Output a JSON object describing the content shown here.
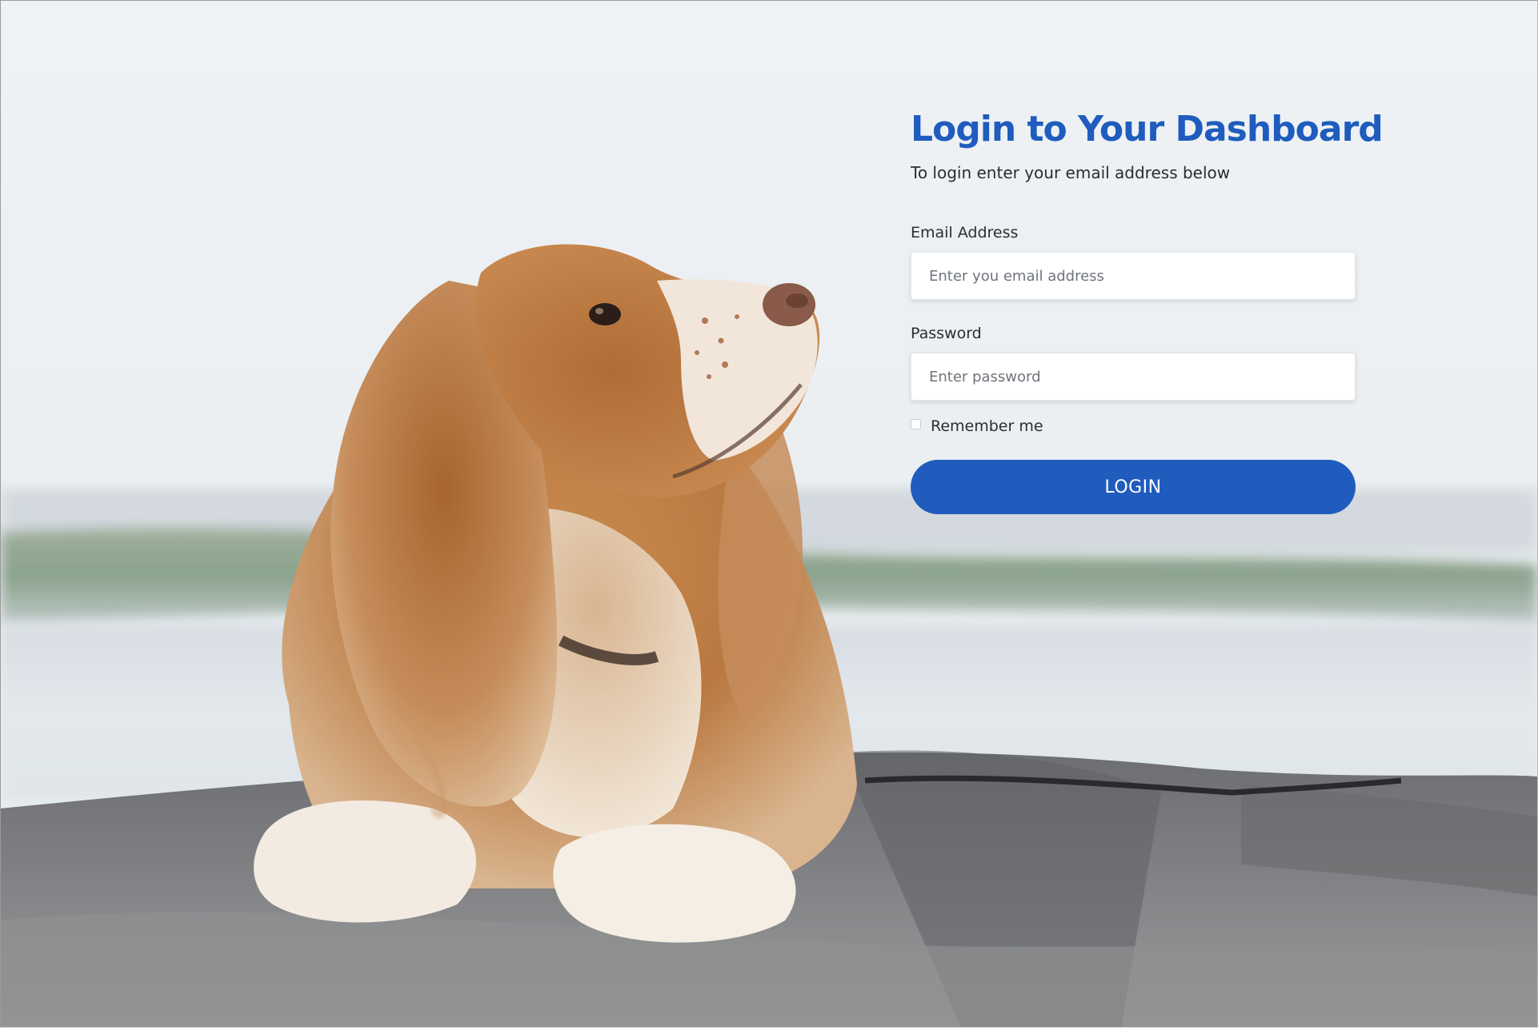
{
  "login": {
    "title": "Login to Your Dashboard",
    "subtitle": "To login enter your email address below",
    "email_label": "Email Address",
    "email_placeholder": "Enter you email address",
    "email_value": "",
    "password_label": "Password",
    "password_placeholder": "Enter password",
    "password_value": "",
    "remember_label": "Remember me",
    "remember_checked": false,
    "button_label": "LOGIN"
  },
  "theme": {
    "accent": "#1f5cbd",
    "text": "#2a2d33",
    "placeholder": "#6f747b"
  }
}
